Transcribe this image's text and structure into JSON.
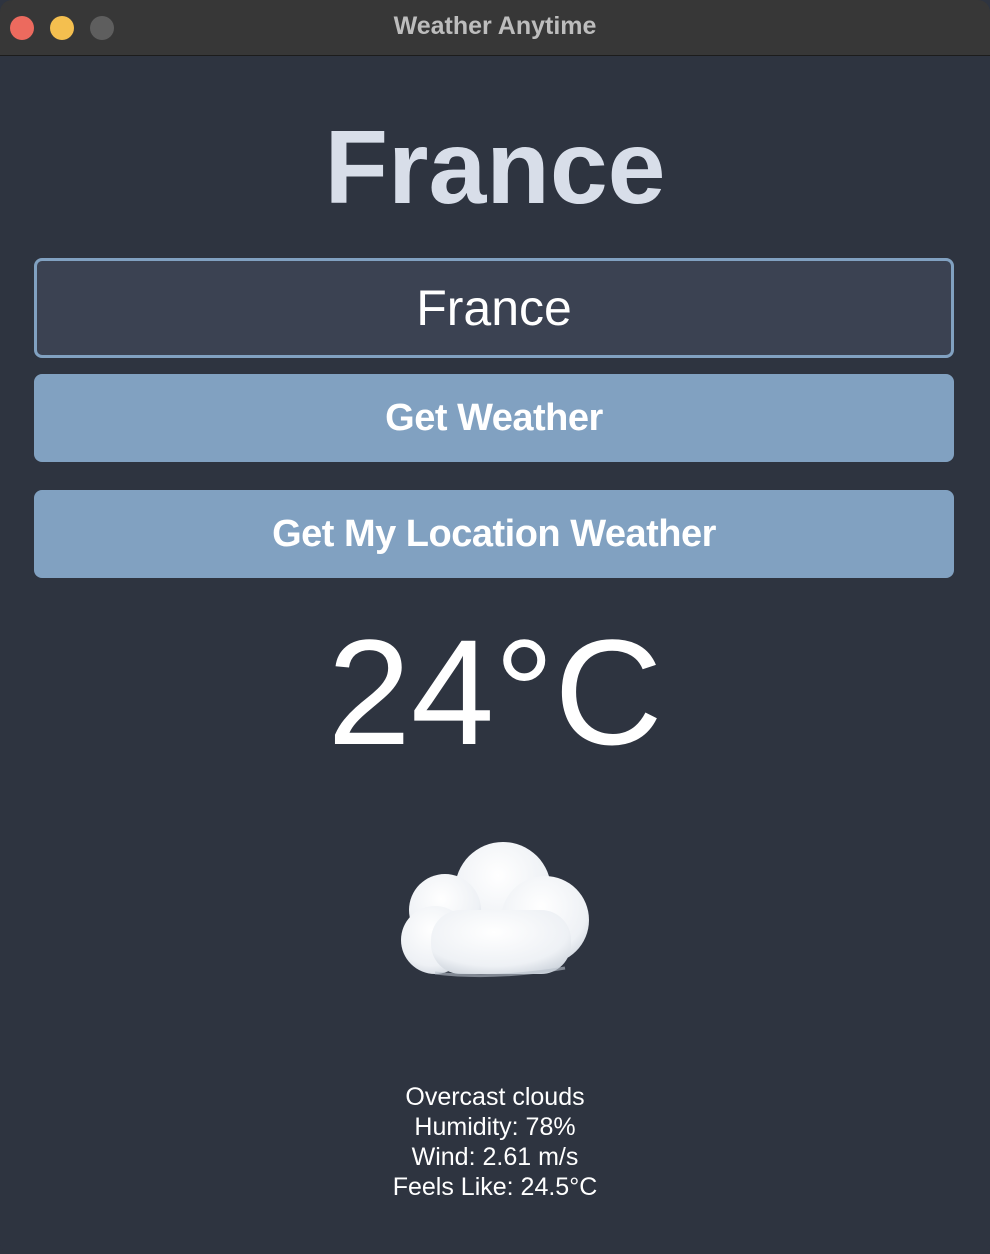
{
  "window": {
    "title": "Weather Anytime"
  },
  "location": {
    "heading": "France"
  },
  "search": {
    "value": "France",
    "placeholder": ""
  },
  "buttons": {
    "get_weather": "Get Weather",
    "my_location": "Get My Location Weather"
  },
  "weather": {
    "temperature": "24°C",
    "icon": "cloud-icon",
    "description": "Overcast clouds",
    "humidity": "Humidity: 78%",
    "wind": "Wind: 2.61 m/s",
    "feels_like": "Feels Like: 24.5°C"
  },
  "colors": {
    "background": "#2e3440",
    "input_background": "#3b4252",
    "accent": "#81a1c1",
    "heading": "#d8dee9",
    "text": "#ffffff"
  }
}
